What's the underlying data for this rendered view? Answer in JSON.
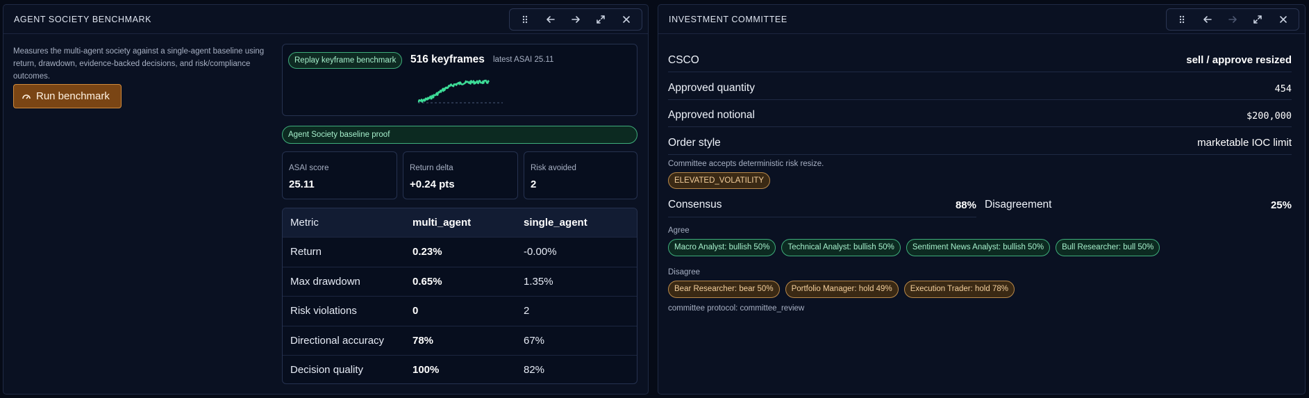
{
  "benchmark": {
    "title": "AGENT SOCIETY BENCHMARK",
    "description": "Measures the multi-agent society against a single-agent baseline using return, drawdown, evidence-backed decisions, and risk/compliance outcomes.",
    "run_label": "Run benchmark",
    "replay_label": "Replay keyframe benchmark",
    "keyframes": "516 keyframes",
    "latest": "latest ASAI 25.11",
    "baseline_label": "Agent Society baseline proof",
    "stats": [
      {
        "label": "ASAI score",
        "value": "25.11"
      },
      {
        "label": "Return delta",
        "value": "+0.24 pts"
      },
      {
        "label": "Risk avoided",
        "value": "2"
      }
    ],
    "table": {
      "headers": [
        "Metric",
        "multi_agent",
        "single_agent"
      ],
      "rows": [
        [
          "Return",
          "0.23%",
          "-0.00%"
        ],
        [
          "Max drawdown",
          "0.65%",
          "1.35%"
        ],
        [
          "Risk violations",
          "0",
          "2"
        ],
        [
          "Directional accuracy",
          "78%",
          "67%"
        ],
        [
          "Decision quality",
          "100%",
          "82%"
        ]
      ]
    }
  },
  "committee": {
    "title": "INVESTMENT COMMITTEE",
    "rows": [
      {
        "key": "CSCO",
        "value": "sell / approve resized"
      },
      {
        "key": "Approved quantity",
        "value": "454"
      },
      {
        "key": "Approved notional",
        "value": "$200,000"
      },
      {
        "key": "Order style",
        "value": "marketable IOC limit"
      }
    ],
    "note": "Committee accepts deterministic risk resize.",
    "flag": "ELEVATED_VOLATILITY",
    "consensus_label": "Consensus",
    "consensus_value": "88%",
    "disagreement_label": "Disagreement",
    "disagreement_value": "25%",
    "agree_label": "Agree",
    "agree": [
      "Macro Analyst: bullish 50%",
      "Technical Analyst: bullish 50%",
      "Sentiment News Analyst: bullish 50%",
      "Bull Researcher: bull 50%"
    ],
    "disagree_label": "Disagree",
    "disagree": [
      "Bear Researcher: bear 50%",
      "Portfolio Manager: hold 49%",
      "Execution Trader: hold 78%"
    ],
    "protocol": "committee protocol: committee_review"
  },
  "colors": {
    "accent_green": "#3fae7c",
    "accent_amber": "#b9894a",
    "run_button": "#7a4514"
  }
}
